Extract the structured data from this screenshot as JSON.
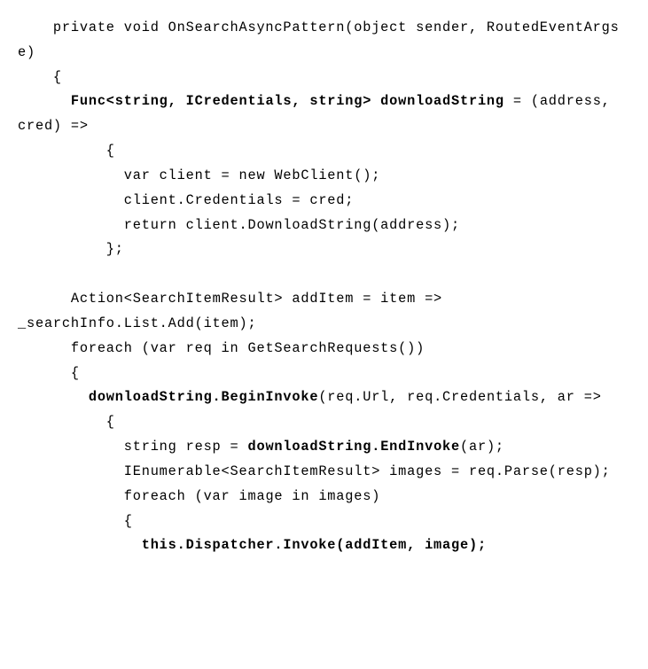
{
  "code": {
    "l1a": "    private void OnSearchAsyncPattern(object sender, RoutedEventArgs e)",
    "l2a": "    {",
    "l3a": "      ",
    "l3b": "Func<string, ICredentials, string> downloadString",
    "l3c": " = (address, cred) =>",
    "l4a": "          {",
    "l5a": "            var client = new WebClient();",
    "l6a": "            client.Credentials = cred;",
    "l7a": "            return client.DownloadString(address);",
    "l8a": "          };",
    "l9a": " ",
    "l10a": "      Action<SearchItemResult> addItem = item => _searchInfo.List.Add(item);",
    "l11a": "      foreach (var req in GetSearchRequests())",
    "l12a": "      {",
    "l13a": "        ",
    "l13b": "downloadString.BeginInvoke",
    "l13c": "(req.Url, req.Credentials, ar =>",
    "l14a": "          {",
    "l15a": "            string resp = ",
    "l15b": "downloadString.",
    "l15c": "EndInvoke",
    "l15d": "(ar);",
    "l16a": "            IEnumerable<SearchItemResult> images = req.Parse(resp);",
    "l17a": "            foreach (var image in images)",
    "l18a": "            {",
    "l19a": "              ",
    "l19b": "this.Dispatcher.Invoke(addItem, image);"
  }
}
